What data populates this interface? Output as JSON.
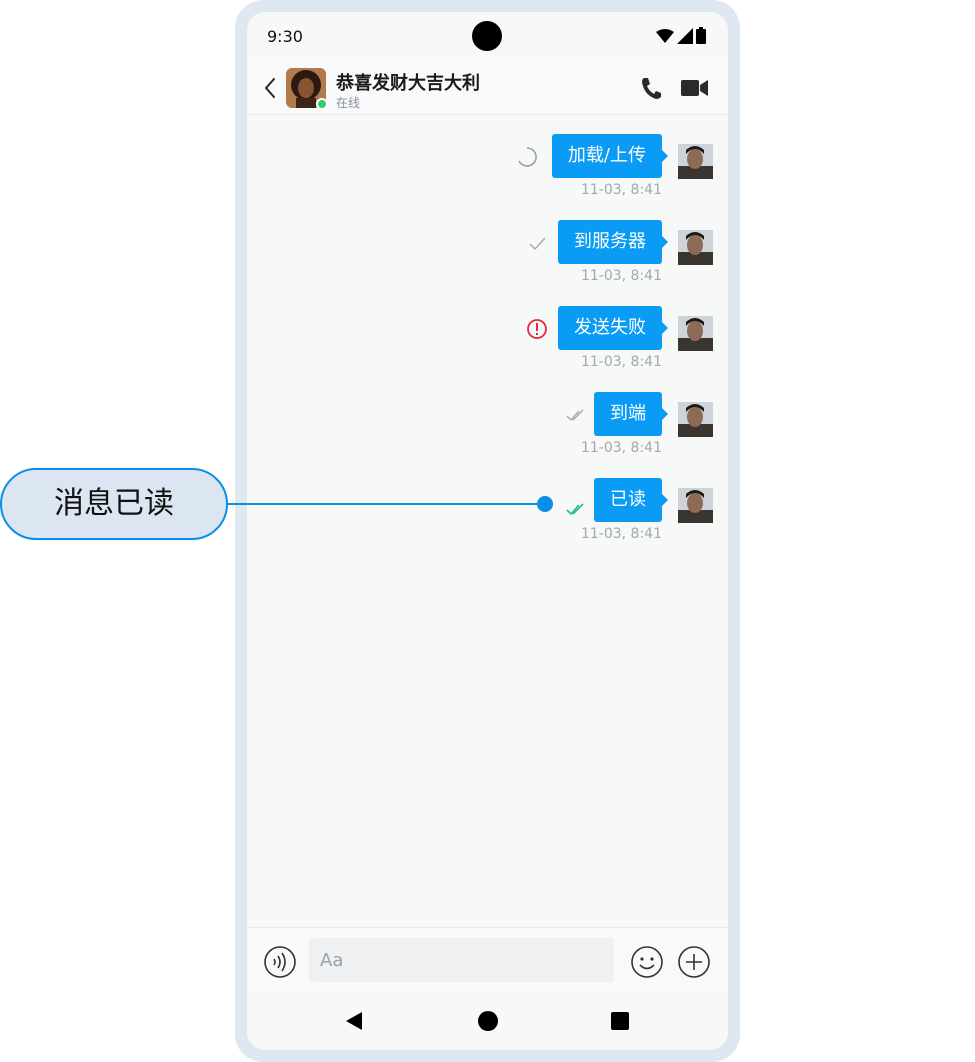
{
  "status_bar": {
    "time": "9:30"
  },
  "header": {
    "contact_name": "恭喜发财大吉大利",
    "presence": "在线"
  },
  "messages": [
    {
      "text": "加载/上传",
      "time": "11-03, 8:41",
      "status": "loading"
    },
    {
      "text": "到服务器",
      "time": "11-03, 8:41",
      "status": "sent"
    },
    {
      "text": "发送失败",
      "time": "11-03, 8:41",
      "status": "failed"
    },
    {
      "text": "到端",
      "time": "11-03, 8:41",
      "status": "delivered"
    },
    {
      "text": "已读",
      "time": "11-03, 8:41",
      "status": "read"
    }
  ],
  "callout": {
    "label": "消息已读"
  },
  "input": {
    "placeholder": "Aa"
  },
  "colors": {
    "bubble": "#0a9bf5",
    "online": "#2ccf6b",
    "read_check": "#19c18a",
    "failed": "#e8273c",
    "callout": "#0a8fe6"
  },
  "icons": [
    "back-icon",
    "phone-icon",
    "video-camera-icon",
    "loading-spinner-icon",
    "check-icon",
    "error-icon",
    "double-check-icon",
    "voice-icon",
    "emoji-icon",
    "plus-icon"
  ]
}
